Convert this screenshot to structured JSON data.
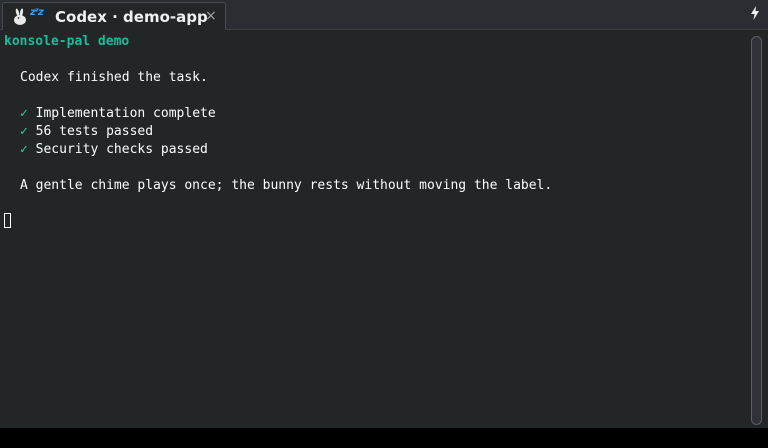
{
  "tab": {
    "icon": "bunny-icon",
    "sleep_badge": "zᶻz",
    "title": "Codex · demo-app",
    "close_label": "×"
  },
  "tabbar": {
    "menu_label": "⬍"
  },
  "terminal": {
    "header": "konsole-pal demo",
    "message": "Codex finished the task.",
    "checks": [
      {
        "mark": "✓",
        "text": "Implementation complete"
      },
      {
        "mark": "✓",
        "text": "56 tests passed"
      },
      {
        "mark": "✓",
        "text": "Security checks passed"
      }
    ],
    "footer": "A gentle chime plays once; the bunny rests without moving the label."
  },
  "colors": {
    "accent": "#1abc9c",
    "check": "#1cdc9a",
    "background": "#232627",
    "text": "#fcfcfc"
  }
}
